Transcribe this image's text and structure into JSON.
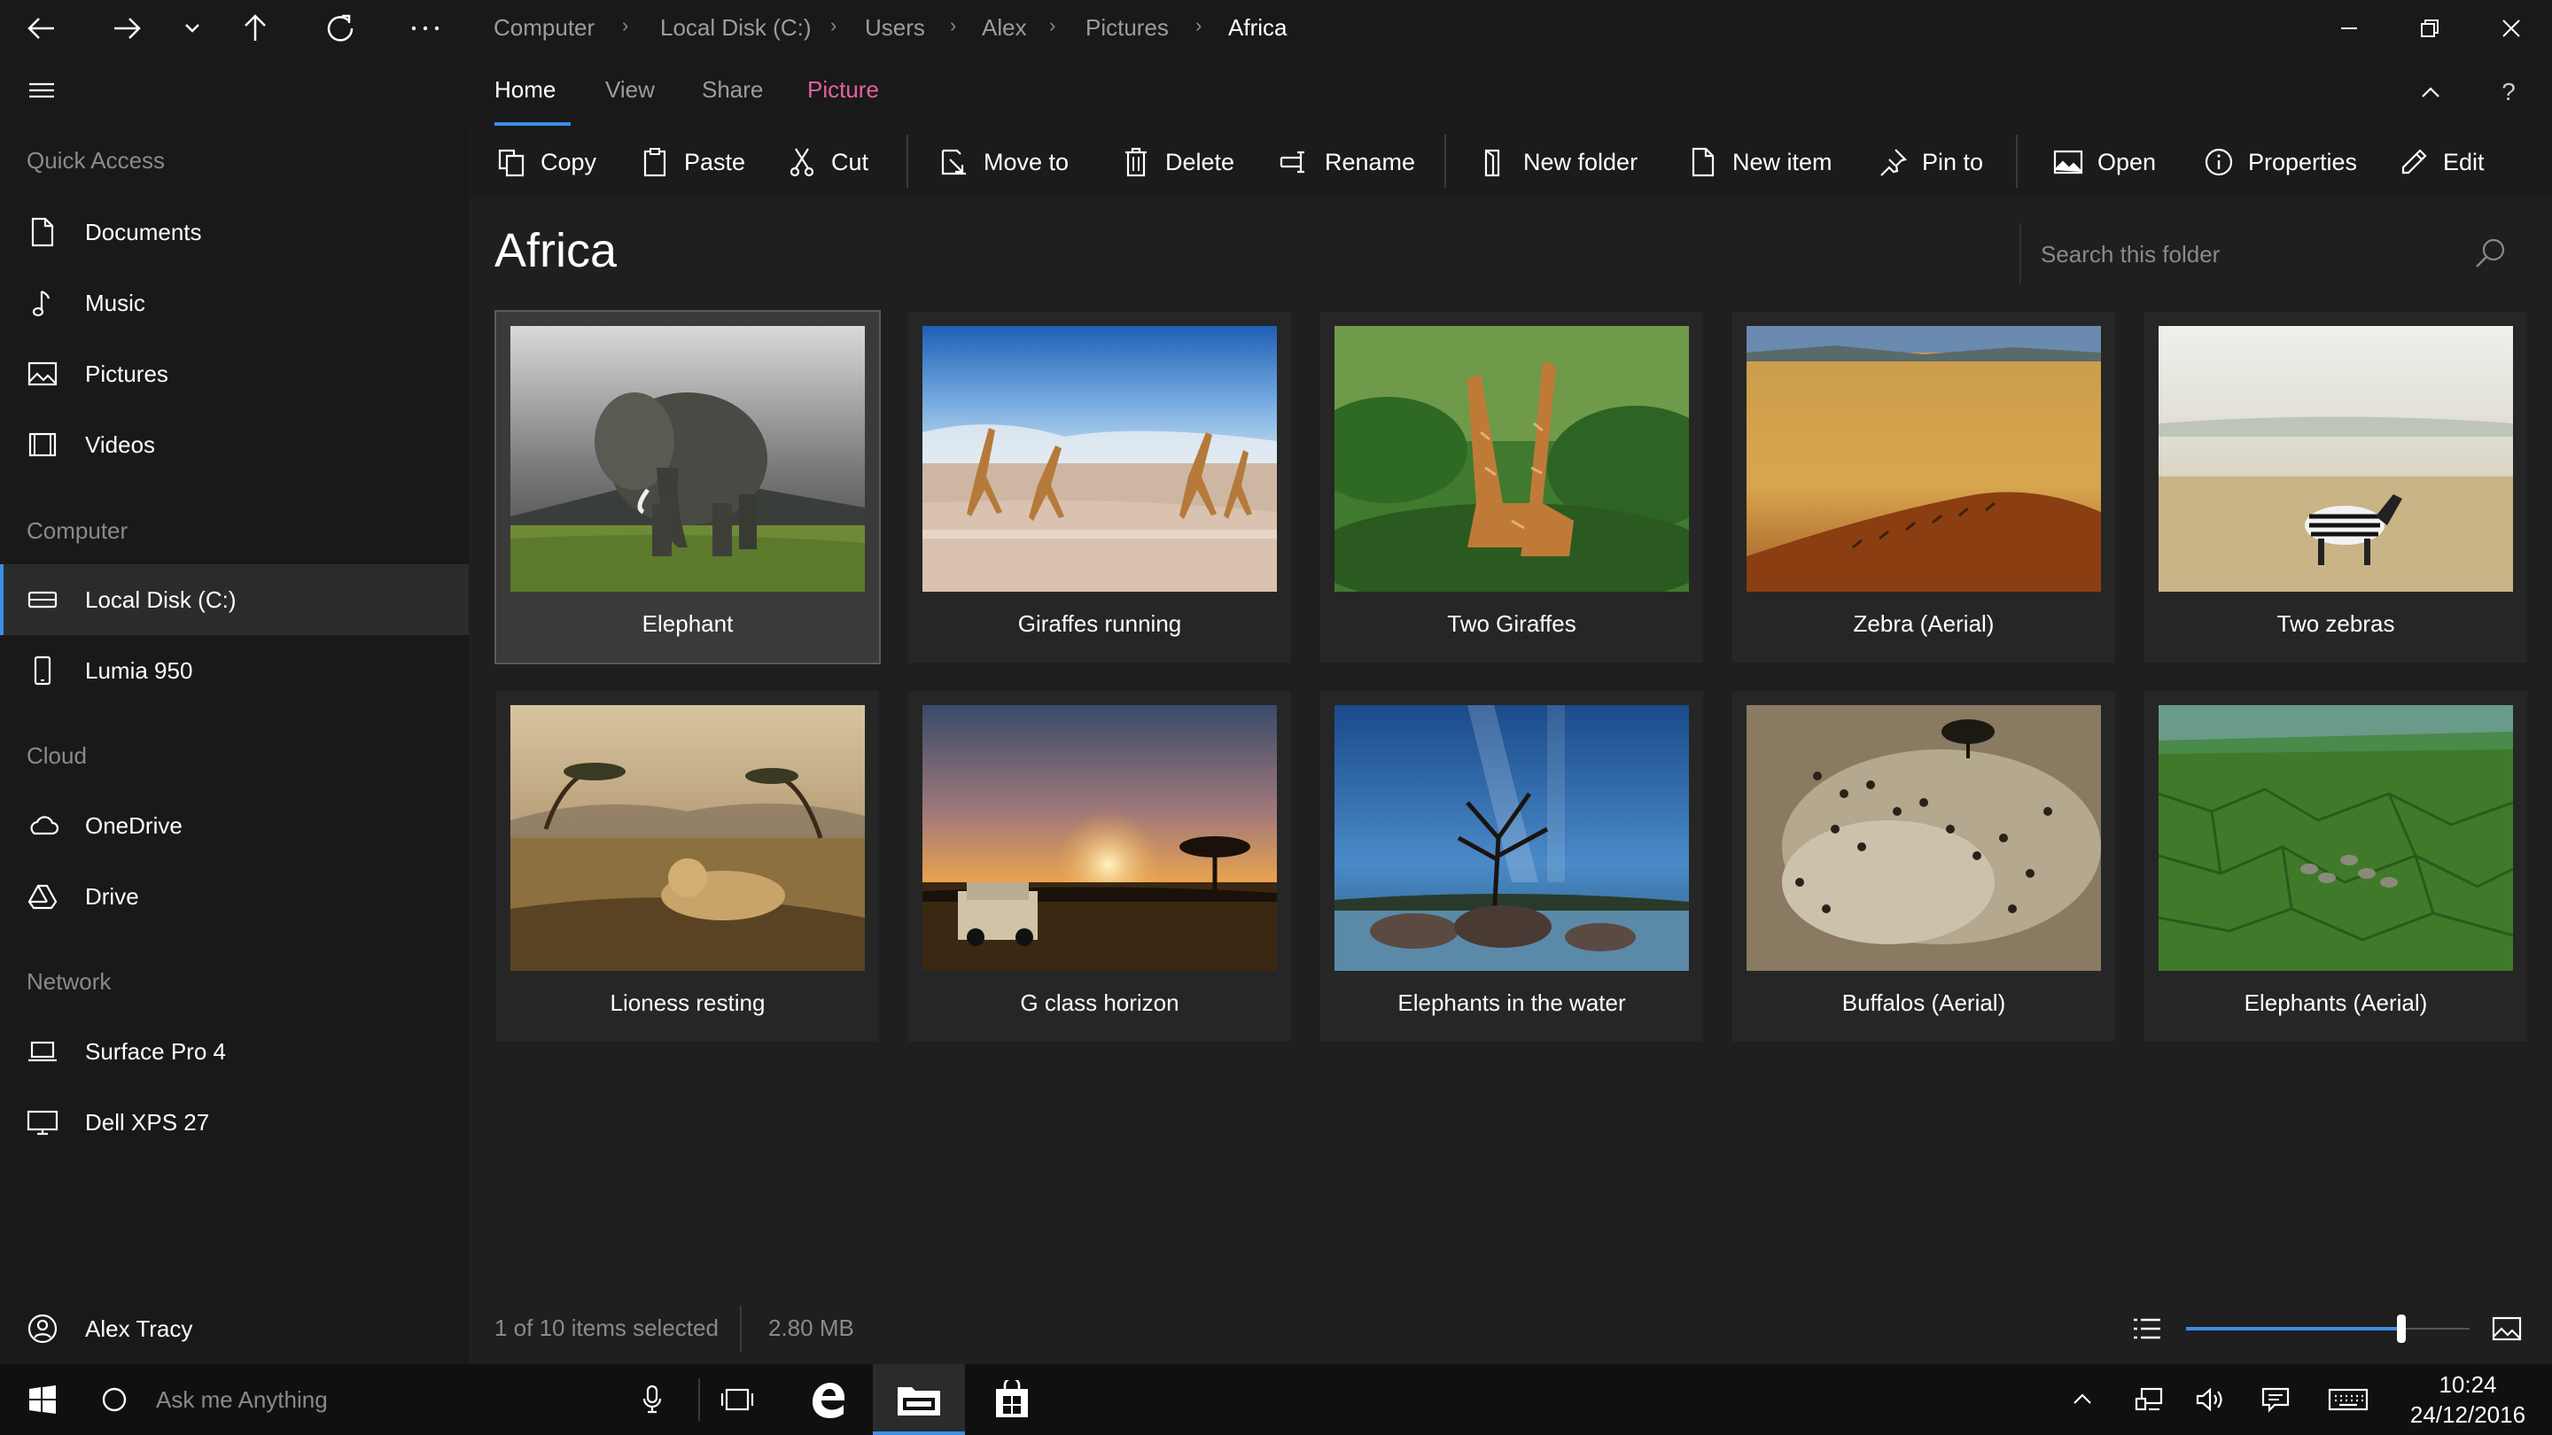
{
  "sidebar": {
    "sections": [
      {
        "heading": "Quick Access",
        "items": [
          {
            "label": "Documents",
            "icon": "document-icon"
          },
          {
            "label": "Music",
            "icon": "music-note-icon"
          },
          {
            "label": "Pictures",
            "icon": "picture-icon"
          },
          {
            "label": "Videos",
            "icon": "video-icon"
          }
        ]
      },
      {
        "heading": "Computer",
        "items": [
          {
            "label": "Local Disk (C:)",
            "icon": "drive-icon",
            "selected": true
          },
          {
            "label": "Lumia 950",
            "icon": "phone-icon"
          }
        ]
      },
      {
        "heading": "Cloud",
        "items": [
          {
            "label": "OneDrive",
            "icon": "cloud-icon"
          },
          {
            "label": "Drive",
            "icon": "triangle-drive-icon"
          }
        ]
      },
      {
        "heading": "Network",
        "items": [
          {
            "label": "Surface Pro 4",
            "icon": "laptop-icon"
          },
          {
            "label": "Dell XPS 27",
            "icon": "monitor-icon"
          }
        ]
      }
    ],
    "user": {
      "name": "Alex Tracy",
      "icon": "user-icon"
    }
  },
  "breadcrumb": [
    "Computer",
    "Local Disk (C:)",
    "Users",
    "Alex",
    "Pictures",
    "Africa"
  ],
  "ribbon": {
    "tabs": [
      "Home",
      "View",
      "Share",
      "Picture"
    ],
    "active_tab": "Home",
    "accent_tab": "Picture",
    "help": "?",
    "commands": [
      {
        "label": "Copy",
        "icon": "copy-icon"
      },
      {
        "label": "Paste",
        "icon": "paste-icon"
      },
      {
        "label": "Cut",
        "icon": "scissors-icon"
      },
      {
        "label": "Move to",
        "icon": "move-to-icon"
      },
      {
        "label": "Delete",
        "icon": "trash-icon"
      },
      {
        "label": "Rename",
        "icon": "rename-icon"
      },
      {
        "label": "New folder",
        "icon": "new-folder-icon"
      },
      {
        "label": "New item",
        "icon": "new-item-icon"
      },
      {
        "label": "Pin to",
        "icon": "pin-icon"
      },
      {
        "label": "Open",
        "icon": "open-image-icon"
      },
      {
        "label": "Properties",
        "icon": "info-icon"
      },
      {
        "label": "Edit",
        "icon": "pencil-icon"
      }
    ]
  },
  "folder": {
    "title": "Africa",
    "search_placeholder": "Search this folder",
    "items": [
      {
        "caption": "Elephant",
        "selected": true
      },
      {
        "caption": "Giraffes running"
      },
      {
        "caption": "Two Giraffes"
      },
      {
        "caption": "Zebra (Aerial)"
      },
      {
        "caption": "Two zebras"
      },
      {
        "caption": "Lioness resting"
      },
      {
        "caption": "G class horizon"
      },
      {
        "caption": "Elephants in the water"
      },
      {
        "caption": "Buffalos (Aerial)"
      },
      {
        "caption": "Elephants (Aerial)"
      }
    ]
  },
  "status": {
    "selection": "1 of 10 items selected",
    "size": "2.80 MB",
    "zoom_fraction": 0.76
  },
  "taskbar": {
    "search_placeholder": "Ask me Anything",
    "time": "10:24",
    "date": "24/12/2016"
  },
  "colors": {
    "accent": "#3b8ee8",
    "picture_tab": "#e8609f"
  }
}
